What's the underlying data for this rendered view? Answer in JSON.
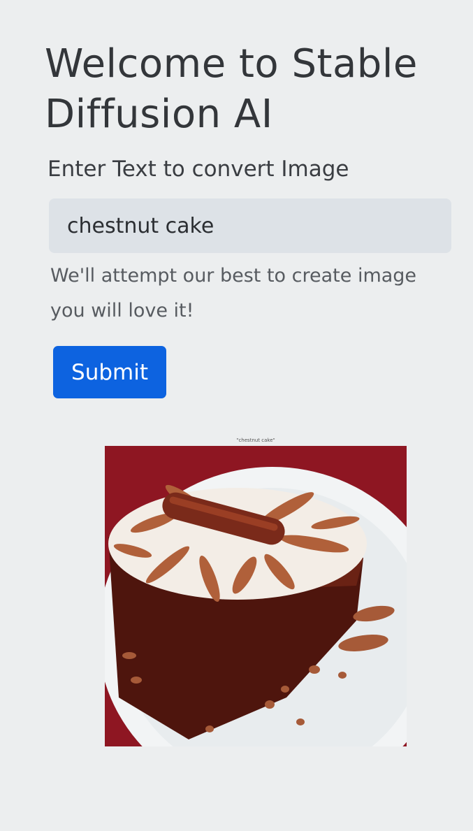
{
  "header": {
    "title": "Welcome to Stable Diffusion AI"
  },
  "form": {
    "label": "Enter Text to convert Image",
    "prompt_value": "chestnut cake",
    "help_text": "We'll attempt our best to create image you will love it!",
    "submit_label": "Submit"
  },
  "result": {
    "caption": "\"chestnut cake\"",
    "image_alt": "Generated image of a chocolate chestnut cake slice on a white plate",
    "colors": {
      "background": "#8e1622",
      "plate": "#f2f4f5",
      "cake": "#5a1a10",
      "cream": "#f3ede6",
      "nut": "#b0603a"
    }
  },
  "theme": {
    "page_background": "#eceeef",
    "input_background": "#dde2e7",
    "button_background": "#0d63e0",
    "button_text": "#ffffff"
  }
}
